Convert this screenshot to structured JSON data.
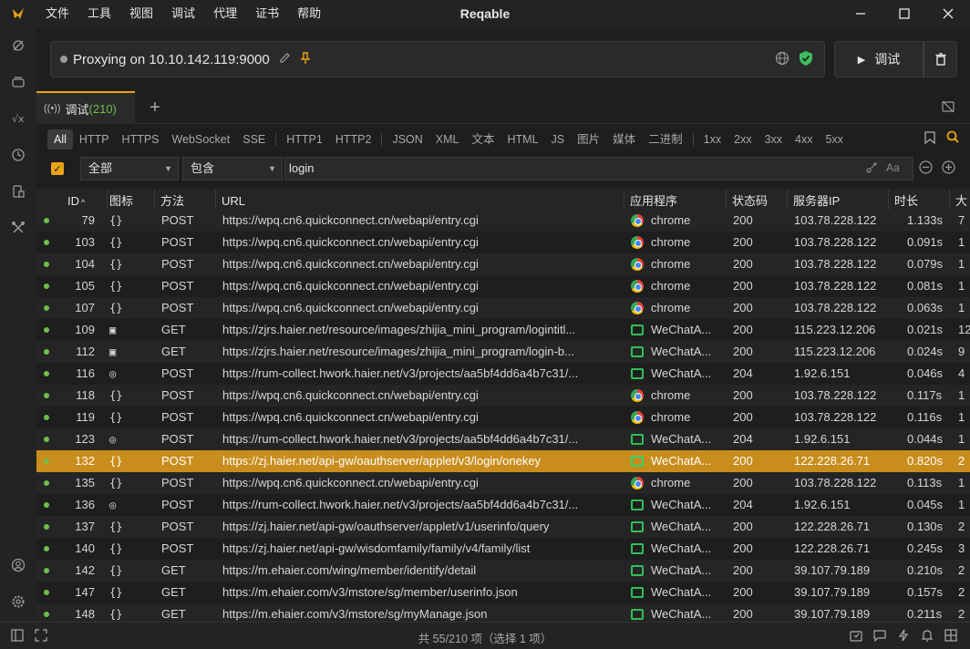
{
  "menu": [
    "文件",
    "工具",
    "视图",
    "调试",
    "代理",
    "证书",
    "帮助"
  ],
  "app_title": "Reqable",
  "proxy": {
    "status_text": "Proxying on 10.10.142.119:9000"
  },
  "debug_button": {
    "label": "调试"
  },
  "tab": {
    "label": "调试",
    "count": "(210)"
  },
  "filters": [
    "HTTP",
    "HTTPS",
    "WebSocket",
    "SSE",
    "HTTP1",
    "HTTP2",
    "JSON",
    "XML",
    "文本",
    "HTML",
    "JS",
    "图片",
    "媒体",
    "二进制",
    "1xx",
    "2xx",
    "3xx",
    "4xx",
    "5xx"
  ],
  "filter_all": "All",
  "search": {
    "scope": "全部",
    "mode": "包含",
    "query": "login",
    "case_label": "Aa"
  },
  "columns": [
    "ID",
    "图标",
    "方法",
    "URL",
    "应用程序",
    "状态码",
    "服务器IP",
    "时长",
    "大"
  ],
  "rows": [
    {
      "id": "79",
      "icon": "{}",
      "method": "POST",
      "url": "https://wpq.cn6.quickconnect.cn/webapi/entry.cgi",
      "app": "chrome",
      "status": "200",
      "ip": "103.78.228.122",
      "dur": "1.133s",
      "size": "7"
    },
    {
      "id": "103",
      "icon": "{}",
      "method": "POST",
      "url": "https://wpq.cn6.quickconnect.cn/webapi/entry.cgi",
      "app": "chrome",
      "status": "200",
      "ip": "103.78.228.122",
      "dur": "0.091s",
      "size": "1"
    },
    {
      "id": "104",
      "icon": "{}",
      "method": "POST",
      "url": "https://wpq.cn6.quickconnect.cn/webapi/entry.cgi",
      "app": "chrome",
      "status": "200",
      "ip": "103.78.228.122",
      "dur": "0.079s",
      "size": "1"
    },
    {
      "id": "105",
      "icon": "{}",
      "method": "POST",
      "url": "https://wpq.cn6.quickconnect.cn/webapi/entry.cgi",
      "app": "chrome",
      "status": "200",
      "ip": "103.78.228.122",
      "dur": "0.081s",
      "size": "1"
    },
    {
      "id": "107",
      "icon": "{}",
      "method": "POST",
      "url": "https://wpq.cn6.quickconnect.cn/webapi/entry.cgi",
      "app": "chrome",
      "status": "200",
      "ip": "103.78.228.122",
      "dur": "0.063s",
      "size": "1"
    },
    {
      "id": "109",
      "icon": "▣",
      "method": "GET",
      "url": "https://zjrs.haier.net/resource/images/zhijia_mini_program/logintitl...",
      "app": "WeChatA...",
      "status": "200",
      "ip": "115.223.12.206",
      "dur": "0.021s",
      "size": "12"
    },
    {
      "id": "112",
      "icon": "▣",
      "method": "GET",
      "url": "https://zjrs.haier.net/resource/images/zhijia_mini_program/login-b...",
      "app": "WeChatA...",
      "status": "200",
      "ip": "115.223.12.206",
      "dur": "0.024s",
      "size": "9"
    },
    {
      "id": "116",
      "icon": "◎",
      "method": "POST",
      "url": "https://rum-collect.hwork.haier.net/v3/projects/aa5bf4dd6a4b7c31/...",
      "app": "WeChatA...",
      "status": "204",
      "ip": "1.92.6.151",
      "dur": "0.046s",
      "size": "4"
    },
    {
      "id": "118",
      "icon": "{}",
      "method": "POST",
      "url": "https://wpq.cn6.quickconnect.cn/webapi/entry.cgi",
      "app": "chrome",
      "status": "200",
      "ip": "103.78.228.122",
      "dur": "0.117s",
      "size": "1"
    },
    {
      "id": "119",
      "icon": "{}",
      "method": "POST",
      "url": "https://wpq.cn6.quickconnect.cn/webapi/entry.cgi",
      "app": "chrome",
      "status": "200",
      "ip": "103.78.228.122",
      "dur": "0.116s",
      "size": "1"
    },
    {
      "id": "123",
      "icon": "◎",
      "method": "POST",
      "url": "https://rum-collect.hwork.haier.net/v3/projects/aa5bf4dd6a4b7c31/...",
      "app": "WeChatA...",
      "status": "204",
      "ip": "1.92.6.151",
      "dur": "0.044s",
      "size": "1"
    },
    {
      "id": "132",
      "icon": "{}",
      "method": "POST",
      "url": "https://zj.haier.net/api-gw/oauthserver/applet/v3/login/onekey",
      "app": "WeChatA...",
      "status": "200",
      "ip": "122.228.26.71",
      "dur": "0.820s",
      "size": "2",
      "selected": true
    },
    {
      "id": "135",
      "icon": "{}",
      "method": "POST",
      "url": "https://wpq.cn6.quickconnect.cn/webapi/entry.cgi",
      "app": "chrome",
      "status": "200",
      "ip": "103.78.228.122",
      "dur": "0.113s",
      "size": "1"
    },
    {
      "id": "136",
      "icon": "◎",
      "method": "POST",
      "url": "https://rum-collect.hwork.haier.net/v3/projects/aa5bf4dd6a4b7c31/...",
      "app": "WeChatA...",
      "status": "204",
      "ip": "1.92.6.151",
      "dur": "0.045s",
      "size": "1"
    },
    {
      "id": "137",
      "icon": "{}",
      "method": "POST",
      "url": "https://zj.haier.net/api-gw/oauthserver/applet/v1/userinfo/query",
      "app": "WeChatA...",
      "status": "200",
      "ip": "122.228.26.71",
      "dur": "0.130s",
      "size": "2"
    },
    {
      "id": "140",
      "icon": "{}",
      "method": "POST",
      "url": "https://zj.haier.net/api-gw/wisdomfamily/family/v4/family/list",
      "app": "WeChatA...",
      "status": "200",
      "ip": "122.228.26.71",
      "dur": "0.245s",
      "size": "3"
    },
    {
      "id": "142",
      "icon": "{}",
      "method": "GET",
      "url": "https://m.ehaier.com/wing/member/identify/detail",
      "app": "WeChatA...",
      "status": "200",
      "ip": "39.107.79.189",
      "dur": "0.210s",
      "size": "2"
    },
    {
      "id": "147",
      "icon": "{}",
      "method": "GET",
      "url": "https://m.ehaier.com/v3/mstore/sg/member/userinfo.json",
      "app": "WeChatA...",
      "status": "200",
      "ip": "39.107.79.189",
      "dur": "0.157s",
      "size": "2"
    },
    {
      "id": "148",
      "icon": "{}",
      "method": "GET",
      "url": "https://m.ehaier.com/v3/mstore/sg/myManage.json",
      "app": "WeChatA...",
      "status": "200",
      "ip": "39.107.79.189",
      "dur": "0.211s",
      "size": "2"
    }
  ],
  "status_bar": {
    "text": "共 55/210 项（选择 1 项）"
  },
  "colors": {
    "accent": "#e8a317",
    "selected_row": "#c98d1e",
    "status_ok": "#6fbf4a"
  }
}
